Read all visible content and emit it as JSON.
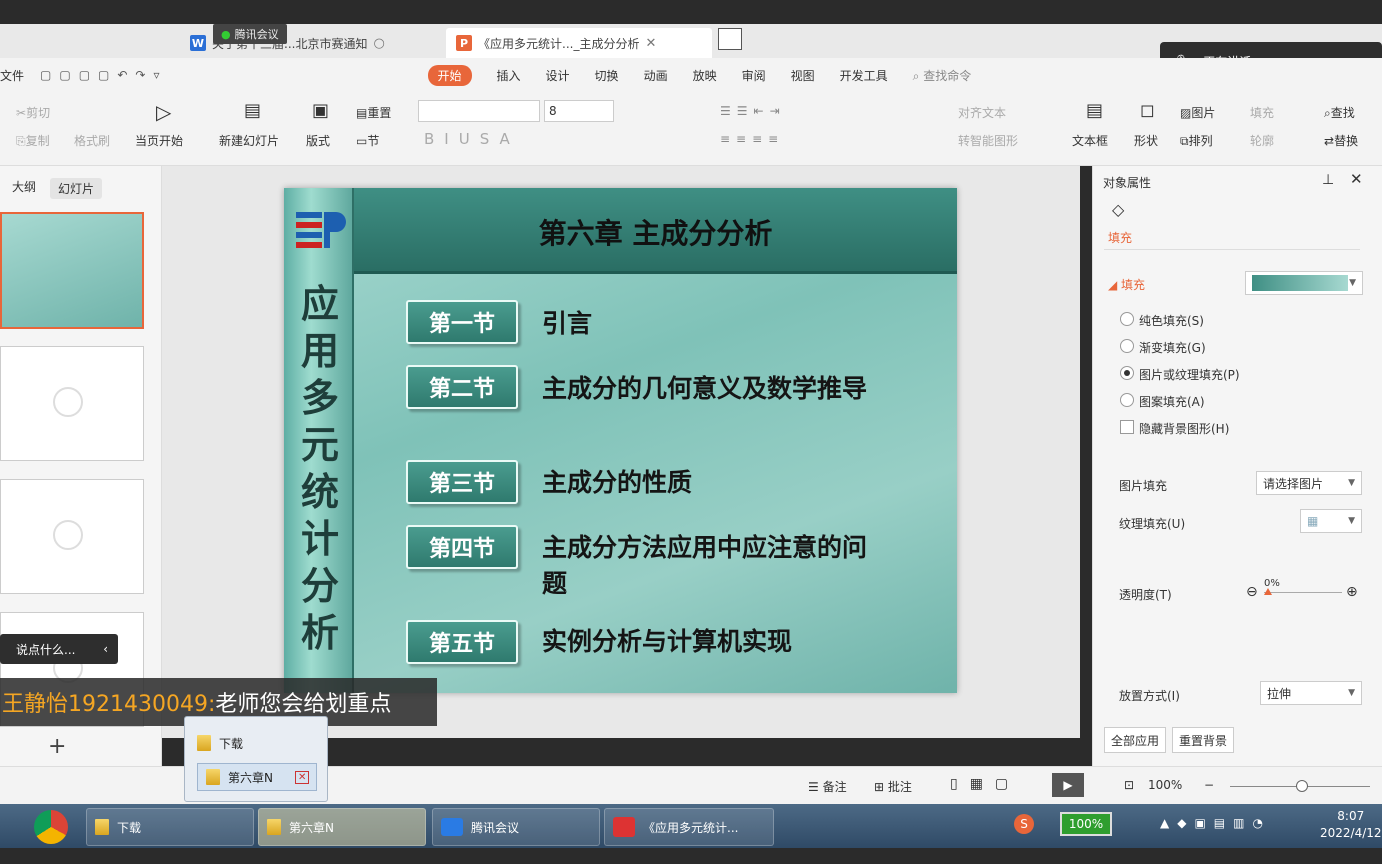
{
  "tabs": [
    {
      "label": "关于第十三届...北京市赛通知",
      "icon": "W"
    },
    {
      "label": "《应用多元统计..._主成分分析",
      "icon": "P"
    }
  ],
  "meeting_label": "腾讯会议",
  "speaking_label": "正在讲话:",
  "file_menu": "文件",
  "menu": [
    "开始",
    "插入",
    "设计",
    "切换",
    "动画",
    "放映",
    "审阅",
    "视图",
    "开发工具"
  ],
  "search_placeholder": "查找命令",
  "ribbon": {
    "cut": "剪切",
    "copy": "复制",
    "format_painter": "格式刷",
    "from_start": "当页开始",
    "new_slide": "新建幻灯片",
    "layout": "版式",
    "reset": "重置",
    "section": "节",
    "font_size": "8",
    "align_text": "对齐文本",
    "smart_shape": "转智能图形",
    "textbox": "文本框",
    "shape": "形状",
    "picture": "图片",
    "fill": "填充",
    "arrange": "排列",
    "outline": "轮廓",
    "find": "查找",
    "replace": "替换"
  },
  "left_pane": {
    "tab_outline": "大纲",
    "tab_slides": "幻灯片"
  },
  "slide": {
    "title": "第六章  主成分分析",
    "vertical_title": "应用多元统计分析",
    "sections": [
      {
        "label": "第一节",
        "text": "引言"
      },
      {
        "label": "第二节",
        "text": "主成分的几何意义及数学推导"
      },
      {
        "label": "第三节",
        "text": "主成分的性质"
      },
      {
        "label": "第四节",
        "text": "主成分方法应用中应注意的问题"
      },
      {
        "label": "第五节",
        "text": "实例分析与计算机实现"
      }
    ]
  },
  "right_pane": {
    "header": "对象属性",
    "tab_fill": "填充",
    "fill_section": "填充",
    "options": [
      "纯色填充(S)",
      "渐变填充(G)",
      "图片或纹理填充(P)",
      "图案填充(A)"
    ],
    "selected_option_index": 2,
    "hide_bg": "隐藏背景图形(H)",
    "picture_fill_label": "图片填充",
    "picture_fill_value": "请选择图片",
    "texture_fill_label": "纹理填充(U)",
    "transparency_label": "透明度(T)",
    "transparency_value": "0%",
    "placement_label": "放置方式(I)",
    "placement_value": "拉伸",
    "apply_all": "全部应用",
    "reset_bg": "重置背景"
  },
  "chat": {
    "placeholder": "说点什么...",
    "message_user": "王静怡1921430049:",
    "message_text": " 老师您会给划重点"
  },
  "statusbar": {
    "notes": "备注",
    "comments": "批注",
    "zoom": "100%"
  },
  "popup": {
    "items": [
      "下载",
      "第六章N"
    ]
  },
  "taskbar": {
    "items": [
      "下载",
      "第六章N",
      "腾讯会议",
      "《应用多元统计..."
    ],
    "battery": "100%",
    "time": "8:07",
    "date": "2022/4/12"
  },
  "colors": {
    "accent": "#e8663a",
    "slide_green": "#2f7a6e"
  }
}
